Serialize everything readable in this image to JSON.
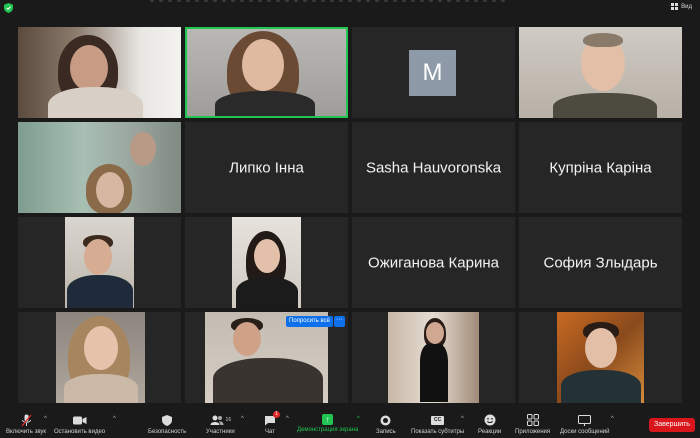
{
  "topbar": {
    "view_label": "Вид"
  },
  "participants_tiles": [
    {
      "type": "video"
    },
    {
      "type": "video",
      "active": true
    },
    {
      "type": "avatar",
      "initial": "M"
    },
    {
      "type": "video"
    },
    {
      "type": "video"
    },
    {
      "type": "name",
      "name": "Липко Інна"
    },
    {
      "type": "name",
      "name": "Sasha Hauvoronska"
    },
    {
      "type": "name",
      "name": "Купріна Каріна"
    },
    {
      "type": "video"
    },
    {
      "type": "video"
    },
    {
      "type": "name",
      "name": "Ожиганова Карина"
    },
    {
      "type": "name",
      "name": "София Злыдарь"
    },
    {
      "type": "video"
    },
    {
      "type": "video"
    },
    {
      "type": "video"
    },
    {
      "type": "video"
    }
  ],
  "popup": {
    "ask_all_label": "Попросить всё",
    "more_label": "···"
  },
  "toolbar": {
    "unmute_label": "Включить звук",
    "stop_video_label": "Остановить видео",
    "security_label": "Безопасность",
    "participants_label": "Участники",
    "participants_count": "16",
    "chat_label": "Чат",
    "chat_badge": "1",
    "share_label": "Демонстрация экрана",
    "record_label": "Запись",
    "captions_label": "Показать субтитры",
    "captions_icon_text": "CC",
    "reactions_label": "Реакции",
    "apps_label": "Приложения",
    "whiteboard_label": "Доски сообщений",
    "end_label": "Завершить"
  },
  "colors": {
    "active_speaker": "#23c552",
    "share_green": "#23c552",
    "end_red": "#d9161b",
    "button_blue": "#0e71eb"
  }
}
